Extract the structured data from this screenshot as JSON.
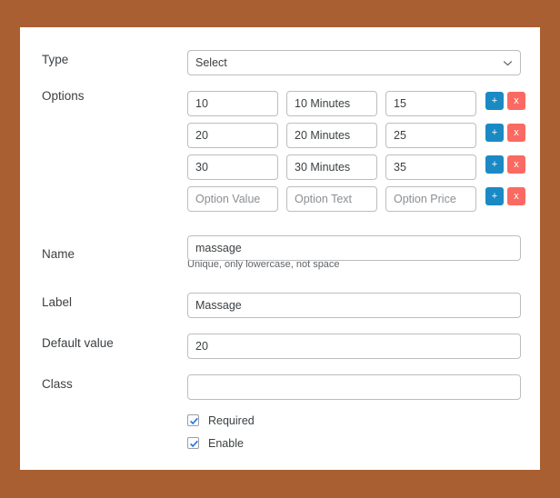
{
  "theme": {
    "page_background": "#a95f31",
    "card_background": "#ffffff",
    "add_button_color": "#1b8ac4",
    "delete_button_color": "#fa6a62",
    "checkbox_check_color": "#1a73e8",
    "border_color": "#bdbdbd",
    "text_color": "#3c4043",
    "placeholder_color": "#8b8e92"
  },
  "form": {
    "type": {
      "label": "Type",
      "selected": "Select",
      "options": [
        "Select"
      ],
      "chevron_icon": "chevron-down-icon"
    },
    "options_section": {
      "label": "Options",
      "column_placeholders": {
        "value": "Option Value",
        "text": "Option Text",
        "price": "Option Price"
      },
      "add_button_label": "+",
      "delete_button_label": "x",
      "rows": [
        {
          "value": "10",
          "text": "10 Minutes",
          "price": "15"
        },
        {
          "value": "20",
          "text": "20 Minutes",
          "price": "25"
        },
        {
          "value": "30",
          "text": "30 Minutes",
          "price": "35"
        },
        {
          "value": "",
          "text": "",
          "price": ""
        }
      ]
    },
    "name": {
      "label": "Name",
      "value": "massage",
      "placeholder": "",
      "help": "Unique, only lowercase, not space"
    },
    "field_label": {
      "label": "Label",
      "value": "Massage",
      "placeholder": ""
    },
    "default_value": {
      "label": "Default value",
      "value": "20",
      "placeholder": ""
    },
    "class": {
      "label": "Class",
      "value": "",
      "placeholder": ""
    },
    "checkboxes": [
      {
        "label": "Required",
        "checked": true
      },
      {
        "label": "Enable",
        "checked": true
      }
    ]
  }
}
